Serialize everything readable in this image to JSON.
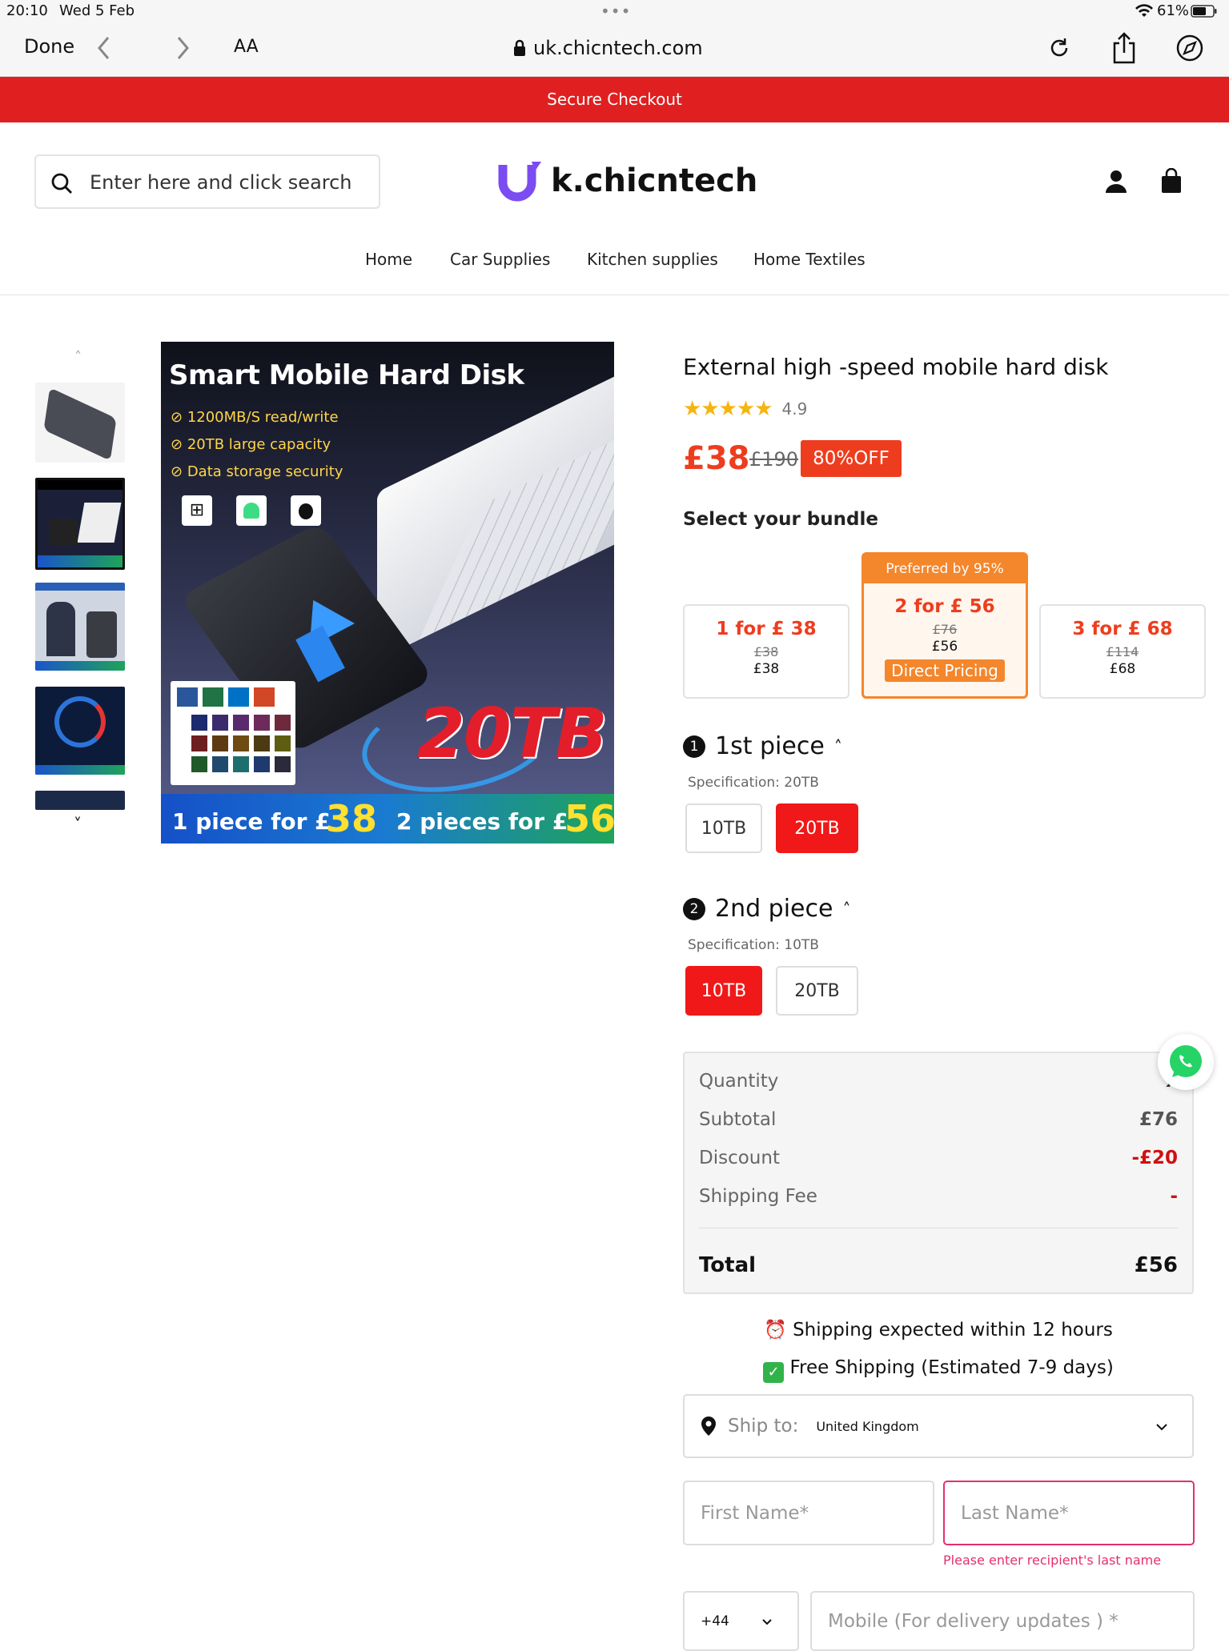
{
  "status_bar": {
    "time": "20:10",
    "date": "Wed 5 Feb",
    "battery": "61%"
  },
  "browser": {
    "done_label": "Done",
    "text_size_label": "AA",
    "url": "uk.chicntech.com"
  },
  "banner": {
    "text": "Secure Checkout"
  },
  "header": {
    "search_placeholder": "Enter here and click search",
    "logo_text": "k.chicntech",
    "nav": [
      "Home",
      "Car Supplies",
      "Kitchen supplies",
      "Home Textiles"
    ]
  },
  "hero": {
    "title": "Smart Mobile Hard Disk",
    "features": [
      "1200MB/S read/write",
      "20TB large capacity",
      "Data storage security"
    ],
    "capacity": "20TB",
    "promo_1_text": "1 piece for £",
    "promo_1_value": "38",
    "promo_2_text": "2 pieces for £",
    "promo_2_value": "56"
  },
  "product": {
    "title": "External high -speed mobile hard disk",
    "rating": "4.9",
    "rating_stars": 5,
    "price": "£38",
    "old_price": "£190",
    "discount_badge": "80%OFF",
    "bundle_heading": "Select your bundle",
    "bundles": [
      {
        "title": "1 for  £ 38",
        "old": "£38",
        "price": "£38"
      },
      {
        "title": "2 for  £ 56",
        "old": "£76",
        "price": "£56",
        "tag": "Preferred by 95%",
        "badge": "Direct Pricing"
      },
      {
        "title": "3 for  £ 68",
        "old": "£114",
        "price": "£68"
      }
    ]
  },
  "pieces": [
    {
      "number": "1",
      "label": "1st piece",
      "spec": "Specification: 20TB",
      "options": [
        "10TB",
        "20TB"
      ],
      "selected": "20TB"
    },
    {
      "number": "2",
      "label": "2nd piece",
      "spec": "Specification: 10TB",
      "options": [
        "10TB",
        "20TB"
      ],
      "selected": "10TB"
    }
  ],
  "summary": {
    "quantity_label": "Quantity",
    "quantity_value": "x",
    "subtotal_label": "Subtotal",
    "subtotal_value": "£76",
    "discount_label": "Discount",
    "discount_value": "-£20",
    "shipping_label": "Shipping Fee",
    "shipping_value": "-",
    "total_label": "Total",
    "total_value": "£56"
  },
  "shipping": {
    "expected": "Shipping expected within 12 hours",
    "free": "Free Shipping (Estimated 7-9 days)"
  },
  "form": {
    "ship_to_label": "Ship to:",
    "country": "United Kingdom",
    "first_name_placeholder": "First Name*",
    "last_name_placeholder": "Last Name*",
    "last_name_error": "Please enter recipient's last name",
    "phone_code": "+44",
    "mobile_placeholder": "Mobile (For delivery updates ) *"
  },
  "colors": {
    "brand_red": "#e02020",
    "price_red": "#ee3d1e",
    "logo_purple": "#7b4cf2",
    "whatsapp_green": "#25d366"
  }
}
